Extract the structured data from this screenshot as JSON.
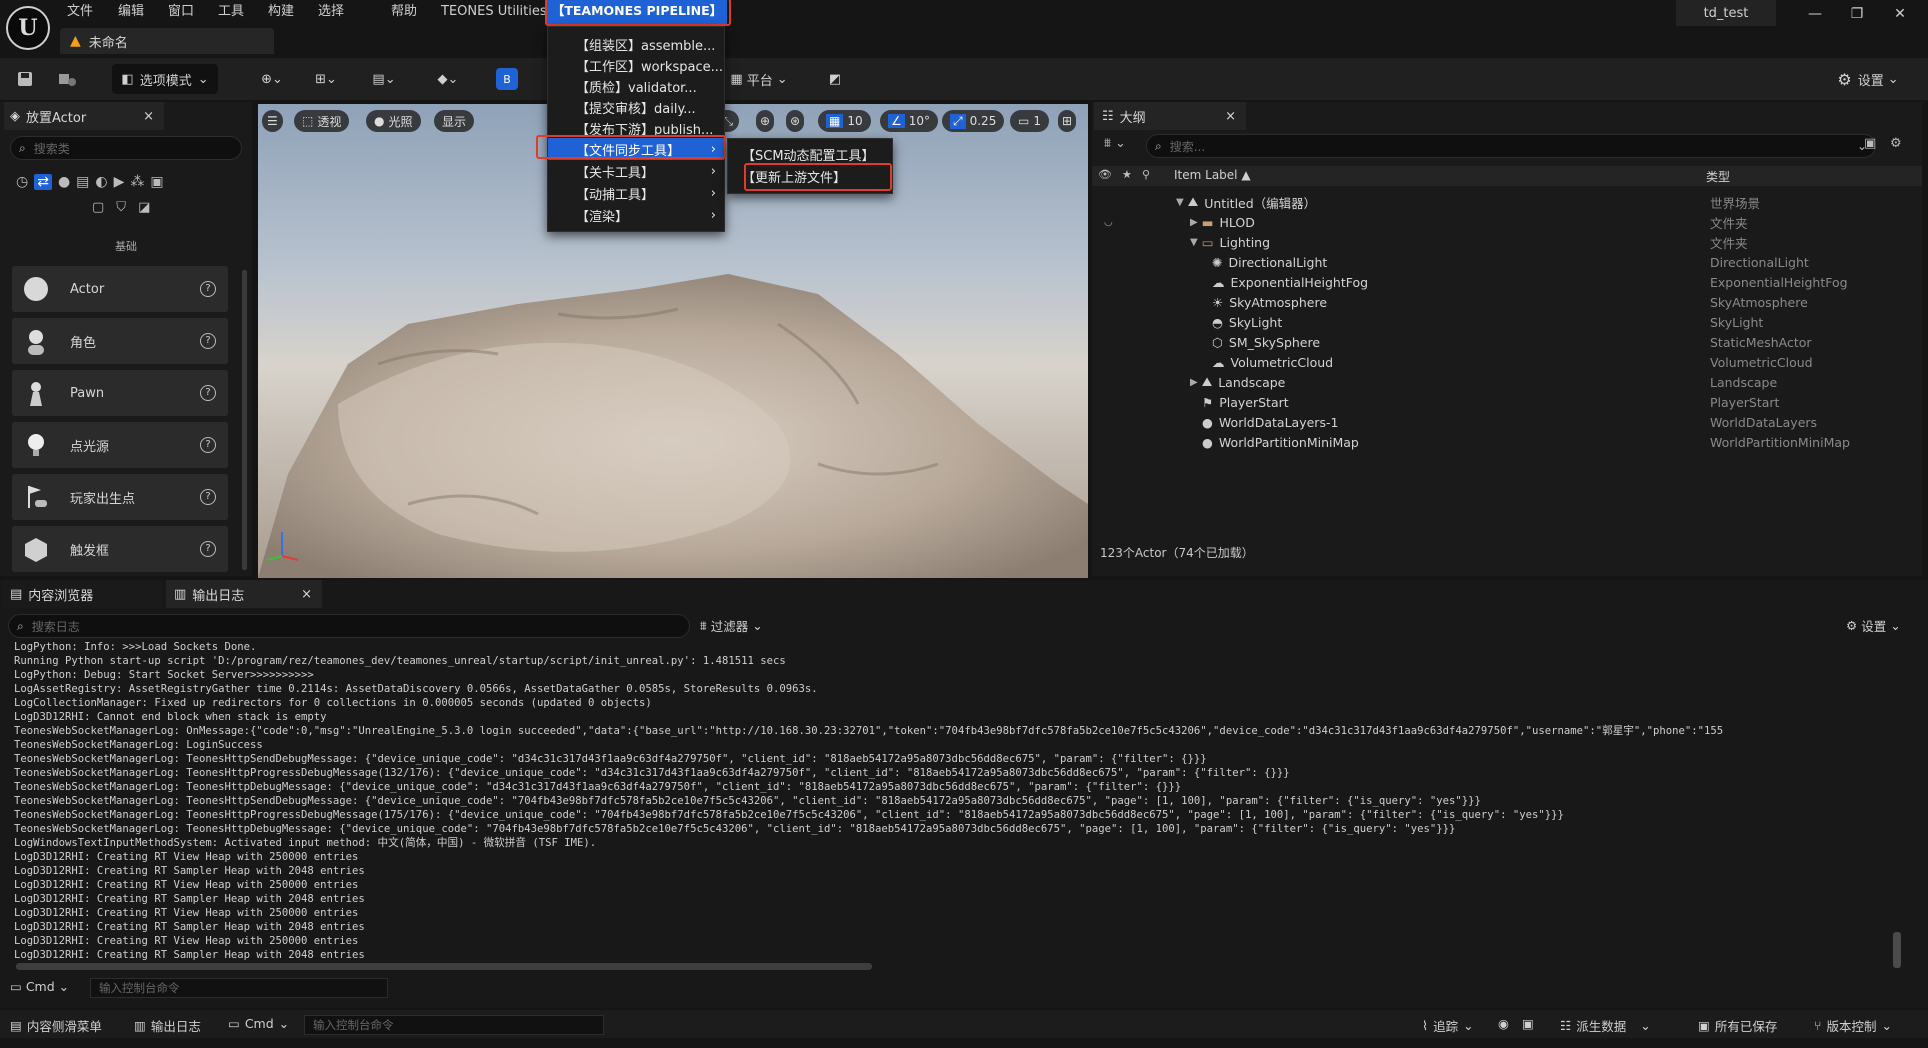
{
  "menubar": {
    "items": [
      "文件",
      "编辑",
      "窗口",
      "工具",
      "构建",
      "选择",
      "帮助",
      "TEONES Utilities",
      "【TEAMONES PIPELINE】"
    ]
  },
  "document_tab": {
    "title": "未命名"
  },
  "window": {
    "user": "td_test"
  },
  "toolbar": {
    "select_mode": "选项模式",
    "platform": "平台",
    "settings": "设置"
  },
  "place_actors": {
    "tab_title": "放置Actor",
    "search_placeholder": "搜索类",
    "section_label": "基础",
    "items": [
      "Actor",
      "角色",
      "Pawn",
      "点光源",
      "玩家出生点",
      "触发框"
    ]
  },
  "viewport": {
    "perspective": "透视",
    "lighting": "光照",
    "show": "显示",
    "grid_snap": "10",
    "rot_snap": "10°",
    "scale_snap": "0.25",
    "camera_speed": "1"
  },
  "outliner": {
    "tab_title": "大纲",
    "search_placeholder": "搜索...",
    "col_label": "Item Label ▲",
    "col_type": "类型",
    "rows": [
      {
        "name": "Untitled（编辑器）",
        "type": "世界场景"
      },
      {
        "name": "HLOD",
        "type": "文件夹"
      },
      {
        "name": "Lighting",
        "type": "文件夹"
      },
      {
        "name": "DirectionalLight",
        "type": "DirectionalLight"
      },
      {
        "name": "ExponentialHeightFog",
        "type": "ExponentialHeightFog"
      },
      {
        "name": "SkyAtmosphere",
        "type": "SkyAtmosphere"
      },
      {
        "name": "SkyLight",
        "type": "SkyLight"
      },
      {
        "name": "SM_SkySphere",
        "type": "StaticMeshActor"
      },
      {
        "name": "VolumetricCloud",
        "type": "VolumetricCloud"
      },
      {
        "name": "Landscape",
        "type": "Landscape"
      },
      {
        "name": "PlayerStart",
        "type": "PlayerStart"
      },
      {
        "name": "WorldDataLayers-1",
        "type": "WorldDataLayers"
      },
      {
        "name": "WorldPartitionMiniMap",
        "type": "WorldPartitionMiniMap"
      }
    ],
    "footer": "123个Actor（74个已加载）"
  },
  "bottom_tabs": {
    "content_browser": "内容浏览器",
    "output_log": "输出日志"
  },
  "log": {
    "search_placeholder": "搜索日志",
    "filters": "过滤器",
    "settings": "设置",
    "lines": [
      "LogPython: Info: >>>Load Sockets Done.",
      "Running Python start-up script 'D:/program/rez/teamones_dev/teamones_unreal/startup/script/init_unreal.py': 1.481511 secs",
      "LogPython: Debug: Start Socket Server>>>>>>>>>>",
      "LogAssetRegistry: AssetRegistryGather time 0.2114s: AssetDataDiscovery 0.0566s, AssetDataGather 0.0585s, StoreResults 0.0963s.",
      "LogCollectionManager: Fixed up redirectors for 0 collections in 0.000005 seconds (updated 0 objects)",
      "LogD3D12RHI: Cannot end block when stack is empty",
      "TeonesWebSocketManagerLog: OnMessage:{\"code\":0,\"msg\":\"UnrealEngine_5.3.0 login succeeded\",\"data\":{\"base_url\":\"http://10.168.30.23:32701\",\"token\":\"704fb43e98bf7dfc578fa5b2ce10e7f5c5c43206\",\"device_code\":\"d34c31c317d43f1aa9c63df4a279750f\",\"username\":\"郭星宇\",\"phone\":\"155",
      "TeonesWebSocketManagerLog: LoginSuccess",
      "TeonesWebSocketManagerLog: TeonesHttpSendDebugMessage: {\"device_unique_code\": \"d34c31c317d43f1aa9c63df4a279750f\", \"client_id\": \"818aeb54172a95a8073dbc56dd8ec675\", \"param\": {\"filter\": {}}}",
      "TeonesWebSocketManagerLog: TeonesHttpProgressDebugMessage(132/176): {\"device_unique_code\": \"d34c31c317d43f1aa9c63df4a279750f\", \"client_id\": \"818aeb54172a95a8073dbc56dd8ec675\", \"param\": {\"filter\": {}}}",
      "TeonesWebSocketManagerLog: TeonesHttpDebugMessage: {\"device_unique_code\": \"d34c31c317d43f1aa9c63df4a279750f\", \"client_id\": \"818aeb54172a95a8073dbc56dd8ec675\", \"param\": {\"filter\": {}}}",
      "TeonesWebSocketManagerLog: TeonesHttpSendDebugMessage: {\"device_unique_code\": \"704fb43e98bf7dfc578fa5b2ce10e7f5c5c43206\", \"client_id\": \"818aeb54172a95a8073dbc56dd8ec675\", \"page\": [1, 100], \"param\": {\"filter\": {\"is_query\": \"yes\"}}}",
      "TeonesWebSocketManagerLog: TeonesHttpProgressDebugMessage(175/176): {\"device_unique_code\": \"704fb43e98bf7dfc578fa5b2ce10e7f5c5c43206\", \"client_id\": \"818aeb54172a95a8073dbc56dd8ec675\", \"page\": [1, 100], \"param\": {\"filter\": {\"is_query\": \"yes\"}}}",
      "TeonesWebSocketManagerLog: TeonesHttpDebugMessage: {\"device_unique_code\": \"704fb43e98bf7dfc578fa5b2ce10e7f5c5c43206\", \"client_id\": \"818aeb54172a95a8073dbc56dd8ec675\", \"page\": [1, 100], \"param\": {\"filter\": {\"is_query\": \"yes\"}}}",
      "LogWindowsTextInputMethodSystem: Activated input method: 中文(简体，中国) - 微软拼音 (TSF IME).",
      "LogD3D12RHI: Creating RT View Heap with 250000 entries",
      "LogD3D12RHI: Creating RT Sampler Heap with 2048 entries",
      "LogD3D12RHI: Creating RT View Heap with 250000 entries",
      "LogD3D12RHI: Creating RT Sampler Heap with 2048 entries",
      "LogD3D12RHI: Creating RT View Heap with 250000 entries",
      "LogD3D12RHI: Creating RT Sampler Heap with 2048 entries",
      "LogD3D12RHI: Creating RT View Heap with 250000 entries",
      "LogD3D12RHI: Creating RT Sampler Heap with 2048 entries"
    ],
    "cmd_label": "Cmd",
    "cmd_placeholder": "输入控制台命令"
  },
  "statusbar": {
    "content_drawer": "内容侧滑菜单",
    "output_log": "输出日志",
    "cmd": "Cmd",
    "cmd_placeholder": "输入控制台命令",
    "trace": "追踪",
    "derived_data": "派生数据",
    "all_saved": "所有已保存",
    "source_control": "版本控制"
  },
  "pipeline_menu": {
    "items": [
      "【组装区】assemble...",
      "【工作区】workspace...",
      "【质检】validator...",
      "【提交审核】daily...",
      "【发布下游】publish...",
      "【文件同步工具】",
      "【关卡工具】",
      "【动捕工具】",
      "【渲染】"
    ]
  },
  "sync_submenu": {
    "items": [
      "【SCM动态配置工具】",
      "【更新上游文件】"
    ]
  },
  "colors": {
    "accent": "#1f62d6",
    "highlight_box": "#e03c2c",
    "warning": "#f0a020"
  }
}
